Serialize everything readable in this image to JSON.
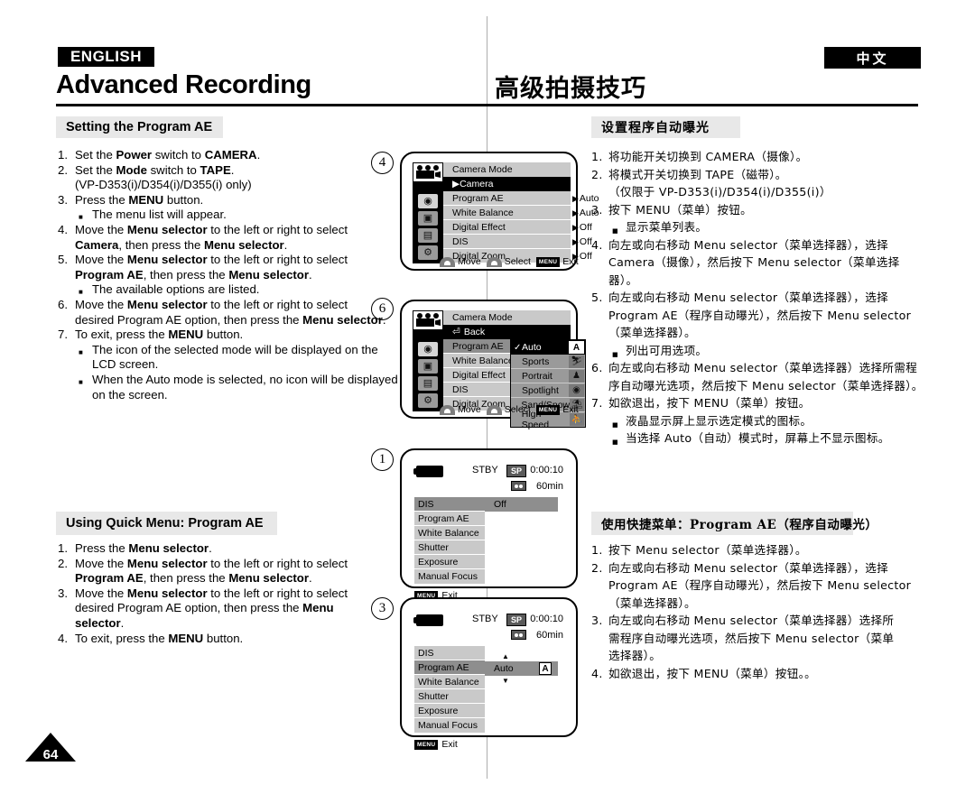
{
  "header": {
    "lang_en": "ENGLISH",
    "lang_zh": "中文",
    "title_en": "Advanced Recording",
    "title_zh": "高级拍摄技巧"
  },
  "section1": {
    "heading_en": "Setting the Program AE",
    "heading_zh": "设置程序自动曝光",
    "steps_en": [
      {
        "num": "1.",
        "parts": [
          "Set the ",
          "B:Power",
          " switch to ",
          "B:CAMERA",
          "."
        ]
      },
      {
        "num": "2.",
        "parts": [
          "Set the ",
          "B:Mode",
          " switch to ",
          "B:TAPE",
          "."
        ]
      },
      {
        "num": "",
        "parts": [
          "(VP-D353(i)/D354(i)/D355(i) only)"
        ]
      },
      {
        "num": "3.",
        "parts": [
          "Press the ",
          "B:MENU",
          " button."
        ]
      },
      {
        "num": "",
        "sub": true,
        "parts": [
          "The menu list will appear."
        ]
      },
      {
        "num": "4.",
        "parts": [
          "Move the ",
          "B:Menu selector",
          " to the left or right to select"
        ]
      },
      {
        "num": "",
        "parts": [
          "B:Camera",
          ", then press the ",
          "B:Menu selector",
          "."
        ]
      },
      {
        "num": "5.",
        "parts": [
          "Move the ",
          "B:Menu selector",
          " to the left or right to select"
        ]
      },
      {
        "num": "",
        "parts": [
          "B:Program AE",
          ", then press the ",
          "B:Menu selector",
          "."
        ]
      },
      {
        "num": "",
        "sub": true,
        "parts": [
          "The available options are listed."
        ]
      },
      {
        "num": "6.",
        "parts": [
          "Move the ",
          "B:Menu selector",
          " to the left or right to select"
        ]
      },
      {
        "num": "",
        "parts": [
          "desired Program AE option, then press the ",
          "B:Menu selector",
          "."
        ]
      },
      {
        "num": "7.",
        "parts": [
          "To exit, press the ",
          "B:MENU",
          " button."
        ]
      },
      {
        "num": "",
        "sub": true,
        "parts": [
          "The icon of the selected mode will be displayed on the"
        ]
      },
      {
        "num": "",
        "indent2": true,
        "parts": [
          "LCD screen."
        ]
      },
      {
        "num": "",
        "sub": true,
        "parts": [
          "When the Auto mode is selected, no icon will be displayed"
        ]
      },
      {
        "num": "",
        "indent2": true,
        "parts": [
          "on the screen."
        ]
      }
    ],
    "steps_zh": [
      {
        "num": "1.",
        "text": "将功能开关切换到 CAMERA（摄像）。"
      },
      {
        "num": "2.",
        "text": "将模式开关切换到 TAPE（磁带）。"
      },
      {
        "num": "",
        "text": "（仅限于 VP-D353(i)/D354(i)/D355(i)）"
      },
      {
        "num": "3.",
        "text": "按下 MENU（菜单）按钮。"
      },
      {
        "num": "",
        "sub": true,
        "text": "显示菜单列表。"
      },
      {
        "num": "4.",
        "text": "向左或向右移动 Menu selector（菜单选择器），选择"
      },
      {
        "num": "",
        "text": "Camera（摄像），然后按下 Menu selector（菜单选择器）。"
      },
      {
        "num": "5.",
        "text": "向左或向右移动 Menu selector（菜单选择器），选择"
      },
      {
        "num": "",
        "text": "Program AE（程序自动曝光），然后按下 Menu selector"
      },
      {
        "num": "",
        "text": "（菜单选择器）。"
      },
      {
        "num": "",
        "sub": true,
        "text": "列出可用选项。"
      },
      {
        "num": "6.",
        "text": "向左或向右移动 Menu selector（菜单选择器）选择所需程"
      },
      {
        "num": "",
        "text": "序自动曝光选项，然后按下 Menu selector（菜单选择器）。"
      },
      {
        "num": "7.",
        "text": "如欲退出，按下 MENU（菜单）按钮。"
      },
      {
        "num": "",
        "sub": true,
        "text": "液晶显示屏上显示选定模式的图标。"
      },
      {
        "num": "",
        "sub": true,
        "text": "当选择 Auto（自动）模式时，屏幕上不显示图标。"
      }
    ]
  },
  "section2": {
    "heading_en": "Using Quick Menu: Program AE",
    "heading_zh": "使用快捷菜单：Program AE（程序自动曝光）",
    "steps_en": [
      {
        "num": "1.",
        "parts": [
          "Press the ",
          "B:Menu selector",
          "."
        ]
      },
      {
        "num": "2.",
        "parts": [
          "Move the ",
          "B:Menu selector",
          " to the left or right to select"
        ]
      },
      {
        "num": "",
        "parts": [
          "B:Program AE",
          ", then press the ",
          "B:Menu selector",
          "."
        ]
      },
      {
        "num": "3.",
        "parts": [
          "Move the ",
          "B:Menu selector",
          " to the left or right to select"
        ]
      },
      {
        "num": "",
        "parts": [
          "desired Program AE option, then press the ",
          "B:Menu"
        ]
      },
      {
        "num": "",
        "parts": [
          "B:selector",
          "."
        ]
      },
      {
        "num": "4.",
        "parts": [
          "To exit, press the ",
          "B:MENU",
          " button."
        ]
      }
    ],
    "steps_zh": [
      {
        "num": "1.",
        "text": "按下 Menu selector（菜单选择器）。"
      },
      {
        "num": "2.",
        "text": "向左或向右移动 Menu selector（菜单选择器），选择"
      },
      {
        "num": "",
        "text": "Program AE（程序自动曝光），然后按下 Menu selector"
      },
      {
        "num": "",
        "text": "（菜单选择器）。"
      },
      {
        "num": "3.",
        "text": "向左或向右移动 Menu selector（菜单选择器）选择所"
      },
      {
        "num": "",
        "text": "需程序自动曝光选项，然后按下 Menu selector（菜单"
      },
      {
        "num": "",
        "text": "选择器）。"
      },
      {
        "num": "4.",
        "text": "如欲退出，按下 MENU（菜单）按钮。。"
      }
    ]
  },
  "screens": {
    "marker4": "4",
    "marker6": "6",
    "marker1": "1",
    "marker3": "3",
    "menu1": {
      "title": "Camera Mode",
      "selected_header": "▶Camera",
      "rows": [
        "Program AE",
        "White Balance",
        "Digital Effect",
        "DIS",
        "Digital Zoom"
      ],
      "values": [
        "Auto",
        "Auto",
        "Off",
        "Off",
        "Off"
      ],
      "hints": {
        "move": "Move",
        "select": "Select",
        "menu_btn": "MENU",
        "exit": "Exit"
      }
    },
    "menu2": {
      "title": "Camera Mode",
      "back_row": "Back",
      "rows": [
        "Program AE",
        "White Balance",
        "Digital Effect",
        "DIS",
        "Digital Zoom"
      ],
      "options": [
        {
          "label": "Auto",
          "icon": "A",
          "selected": true
        },
        {
          "label": "Sports",
          "icon": "⛷",
          "selected": false
        },
        {
          "label": "Portrait",
          "icon": "♟",
          "selected": false
        },
        {
          "label": "Spotlight",
          "icon": "◉",
          "selected": false
        },
        {
          "label": "Sand/Snow",
          "icon": "⛱",
          "selected": false
        },
        {
          "label": "High Speed",
          "icon": "⛹",
          "selected": false
        }
      ],
      "hints": {
        "move": "Move",
        "select": "Select",
        "menu_btn": "MENU",
        "exit": "Exit"
      }
    },
    "quick1": {
      "status": "STBY",
      "quality": "SP",
      "timecode": "0:00:10",
      "tape_length": "60min",
      "rows": [
        "DIS",
        "Program AE",
        "White Balance",
        "Shutter",
        "Exposure",
        "Manual Focus"
      ],
      "highlight_index": 0,
      "value": "Off",
      "menu_btn": "MENU",
      "exit": "Exit"
    },
    "quick2": {
      "status": "STBY",
      "quality": "SP",
      "timecode": "0:00:10",
      "tape_length": "60min",
      "rows": [
        "DIS",
        "Program AE",
        "White Balance",
        "Shutter",
        "Exposure",
        "Manual Focus"
      ],
      "highlight_index": 1,
      "value": "Auto",
      "value_icon": "A",
      "up_arrow": "▲",
      "down_arrow": "▼",
      "menu_btn": "MENU",
      "exit": "Exit"
    }
  },
  "footer": {
    "page_number": "64"
  }
}
